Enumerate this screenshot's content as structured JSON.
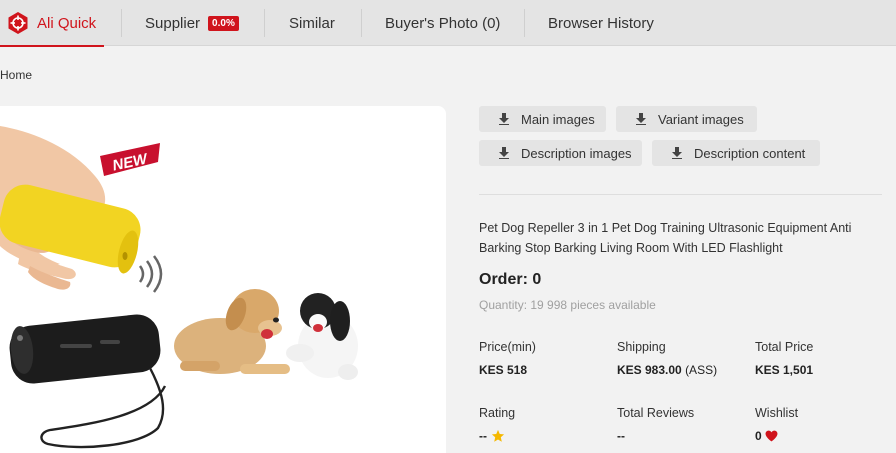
{
  "nav": {
    "brand": "Ali Quick",
    "supplier_label": "Supplier",
    "supplier_badge": "0.0%",
    "similar_label": "Similar",
    "buyers_photo_label": "Buyer's Photo (0)",
    "history_label": "Browser History"
  },
  "breadcrumb": "Home",
  "image": {
    "sticker_text": "NEW"
  },
  "downloads": {
    "main_images": "Main images",
    "variant_images": "Variant images",
    "description_images": "Description images",
    "description_content": "Description content"
  },
  "product": {
    "title": "Pet Dog Repeller 3 in 1 Pet Dog Training Ultrasonic Equipment Anti Barking Stop Barking Living Room With LED Flashlight",
    "order": "Order: 0",
    "quantity": "Quantity: 19 998 pieces available"
  },
  "stats": {
    "price_label": "Price(min)",
    "price_value": "KES 518",
    "shipping_label": "Shipping",
    "shipping_value": "KES 983.00",
    "shipping_method": "(ASS)",
    "total_label": "Total Price",
    "total_value": "KES 1,501",
    "rating_label": "Rating",
    "rating_value": "--",
    "reviews_label": "Total Reviews",
    "reviews_value": "--",
    "wishlist_label": "Wishlist",
    "wishlist_value": "0"
  },
  "colors": {
    "accent": "#d0141c",
    "star": "#f5b800",
    "device_yellow": "#f2d422",
    "device_black": "#1c1c1c"
  }
}
